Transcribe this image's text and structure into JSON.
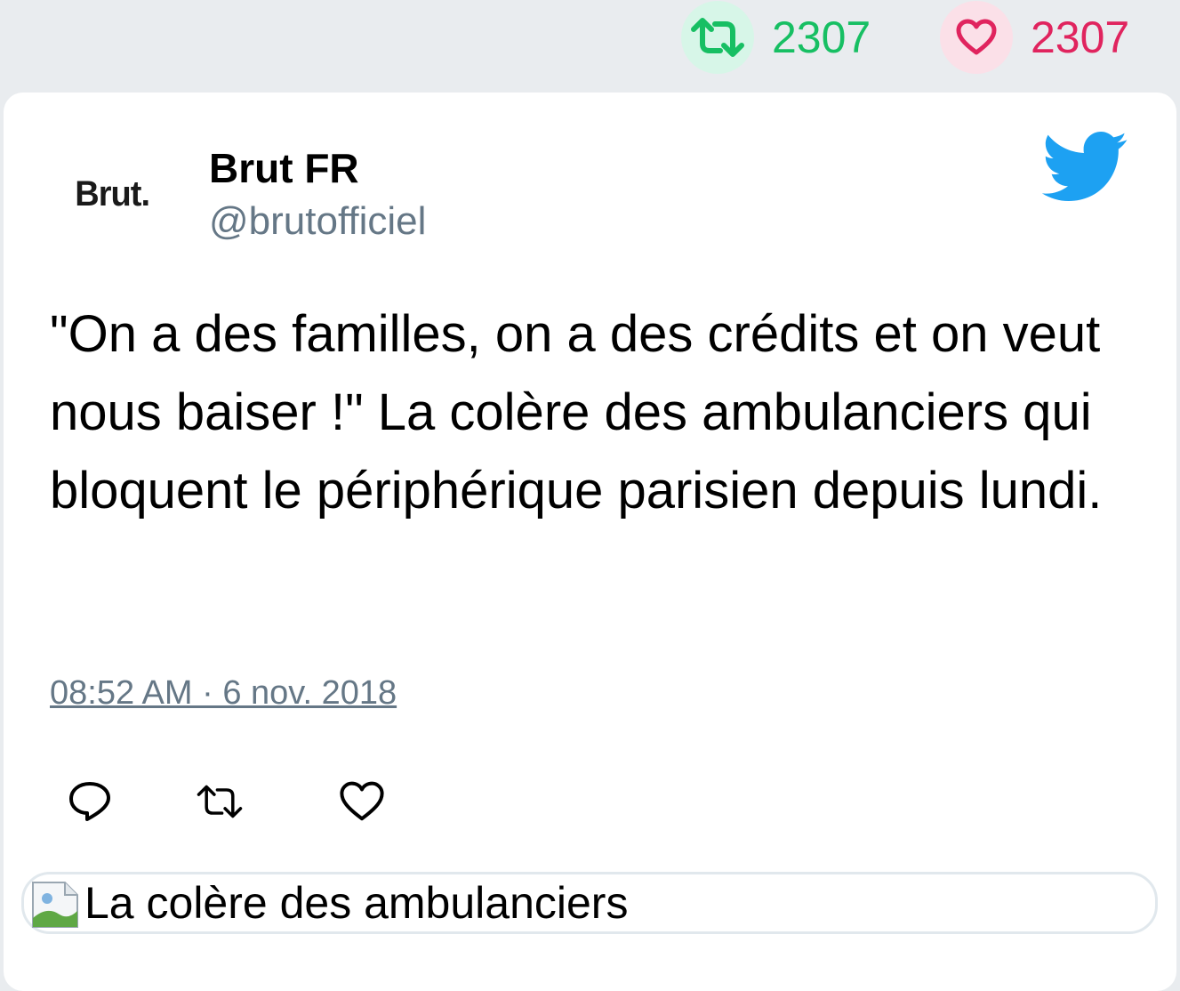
{
  "stats": {
    "retweet_count": "2307",
    "like_count": "2307",
    "retweet_color": "#17bf63",
    "like_color": "#e0245e"
  },
  "tweet": {
    "avatar_text": "Brut.",
    "display_name": "Brut FR",
    "handle": "@brutofficiel",
    "text": "\"On a des familles, on a des crédits et on veut nous baiser !\" La colère des ambulanciers qui bloquent le périphérique parisien depuis lundi.",
    "timestamp": "08:52 AM · 6 nov. 2018",
    "media_alt": "La colère des ambulanciers"
  },
  "icons": {
    "brand": "twitter-bird-icon",
    "actions": [
      "reply-icon",
      "retweet-icon",
      "like-icon"
    ]
  },
  "colors": {
    "twitter_blue": "#1da1f2",
    "handle_gray": "#657786"
  }
}
